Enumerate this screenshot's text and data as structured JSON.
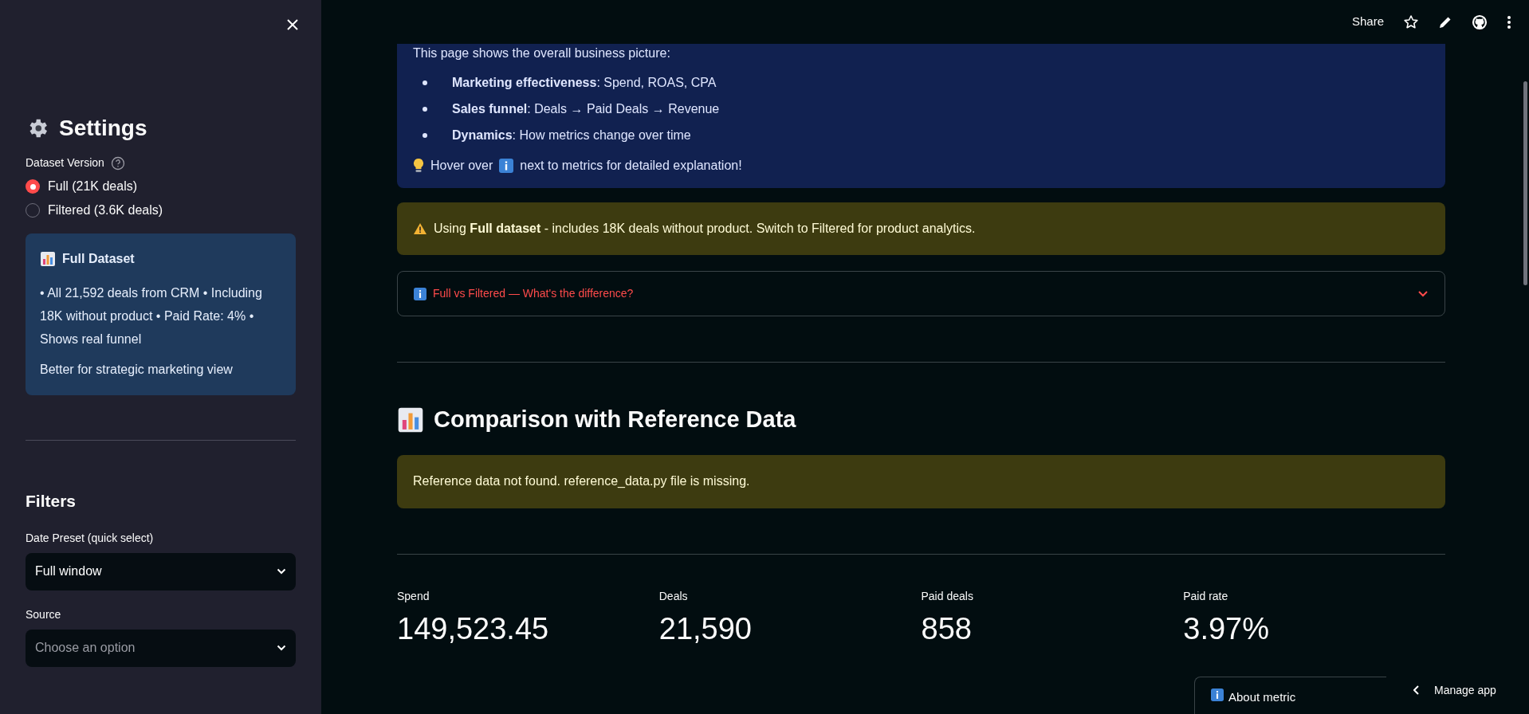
{
  "header": {
    "share": "Share"
  },
  "sidebar": {
    "title": "Settings",
    "dataset_version": {
      "label": "Dataset Version",
      "options": [
        {
          "label": "Full (21K deals)",
          "selected": true
        },
        {
          "label": "Filtered (3.6K deals)",
          "selected": false
        }
      ]
    },
    "info_card": {
      "title": "Full Dataset",
      "text": "• All 21,592 deals from CRM • Including 18K without product • Paid Rate: 4% • Shows real funnel",
      "note": "Better for strategic marketing view"
    },
    "filters": {
      "title": "Filters",
      "fields": [
        {
          "label": "Date Preset (quick select)",
          "value": "Full window"
        },
        {
          "label": "Source",
          "placeholder": "Choose an option"
        }
      ]
    }
  },
  "main": {
    "intro": {
      "text": "This page shows the overall business picture:",
      "bullets": [
        "**Marketing effectiveness**: Spend, ROAS, CPA",
        "**Sales funnel**: Deals → Paid Deals → Revenue",
        "**Dynamics**: How metrics change over time"
      ],
      "hint_before": "Hover over",
      "hint_after": "next to metrics for detailed explanation!"
    },
    "warning": "Using **Full dataset** - includes 18K deals without product. Switch to Filtered for product analytics.",
    "expander": {
      "label": "Full vs Filtered — What's the difference?",
      "expanded": false
    },
    "section_title": "Comparison with Reference Data",
    "reference_warning": "Reference data not found. reference_data.py file is missing.",
    "metrics": [
      {
        "label": "Spend",
        "value": "149,523.45"
      },
      {
        "label": "Deals",
        "value": "21,590"
      },
      {
        "label": "Paid deals",
        "value": "858"
      },
      {
        "label": "Paid rate",
        "value": "3.97%"
      }
    ],
    "about_metric": "About metric"
  },
  "manage_app": "Manage app"
}
